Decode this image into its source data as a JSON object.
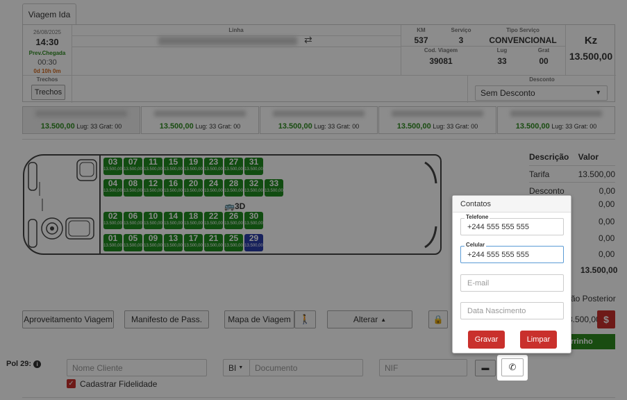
{
  "tab": {
    "label": "Viagem Ida"
  },
  "trip": {
    "date": "26/08/2025",
    "time": "14:30",
    "arrival_label": "Prev.Chegada",
    "arrival_time": "00:30",
    "duration": "0d 10h 0m",
    "linha_label": "Linha",
    "km_label": "KM",
    "km": "537",
    "servico_label": "Serviço",
    "servico": "3",
    "tipo_label": "Tipo Serviço",
    "tipo": "CONVENCIONAL",
    "cod_label": "Cod. Viagem",
    "cod": "39081",
    "lug_label": "Lug",
    "lug": "33",
    "grat_label": "Grat",
    "grat": "00",
    "currency": "Kz",
    "price": "13.500,00",
    "trechos_label": "Trechos",
    "trechos_button": "Trechos",
    "desconto_label": "Desconto",
    "desconto_value": "Sem Desconto"
  },
  "trechos": [
    {
      "price": "13.500,00",
      "info": "Lug: 33 Grat: 00"
    },
    {
      "price": "13.500,00",
      "info": "Lug: 33 Grat: 00"
    },
    {
      "price": "13.500,00",
      "info": "Lug: 33 Grat: 00"
    },
    {
      "price": "13.500,00",
      "info": "Lug: 33 Grat: 00"
    },
    {
      "price": "13.500,00",
      "info": "Lug: 33 Grat: 00"
    }
  ],
  "seats": {
    "price_label": "13.500,00",
    "row1": [
      "03",
      "07",
      "11",
      "15",
      "19",
      "23",
      "27",
      "31"
    ],
    "row2": [
      "04",
      "08",
      "12",
      "16",
      "20",
      "24",
      "28",
      "32",
      "33"
    ],
    "row3": [
      "02",
      "06",
      "10",
      "14",
      "18",
      "22",
      "26",
      "30"
    ],
    "row4": [
      "01",
      "05",
      "09",
      "13",
      "17",
      "21",
      "25",
      "29"
    ],
    "selected": "29",
    "label_3d": "3D"
  },
  "summary": {
    "col1": "Descrição",
    "col2": "Valor",
    "rows": [
      {
        "label": "Tarifa",
        "value": "13.500,00"
      },
      {
        "label": "Desconto",
        "value": "0,00"
      }
    ],
    "partial_values": [
      "0,00",
      "0,00",
      "0,00",
      "0,00"
    ],
    "total": "13.500,00",
    "posterior": "ssão Posterior",
    "pay_value": "3.500,00",
    "carrinho": "rrinho"
  },
  "buttons": {
    "aproveitamento": "Aproveitamento Viagem",
    "manifesto": "Manifesto de Pass.",
    "mapa": "Mapa de Viagem",
    "alterar": "Alterar"
  },
  "passenger": {
    "label": "Pol 29:",
    "nome_placeholder": "Nome Cliente",
    "doc_type": "BI",
    "doc_placeholder": "Documento",
    "nif_placeholder": "NIF",
    "fidelidade": "Cadastrar Fidelidade"
  },
  "contatos": {
    "title": "Contatos",
    "telefone_label": "Telefone",
    "telefone": "+244 555 555 555",
    "celular_label": "Celular",
    "celular": "+244 555 555 555",
    "email_placeholder": "E-mail",
    "nascimento_placeholder": "Data Nascimento",
    "gravar": "Gravar",
    "limpar": "Limpar"
  },
  "colors": {
    "seat": "#1f8a1f",
    "seat_selected": "#2a3da8",
    "danger": "#c9302c",
    "price_green": "#2e8b1f"
  }
}
